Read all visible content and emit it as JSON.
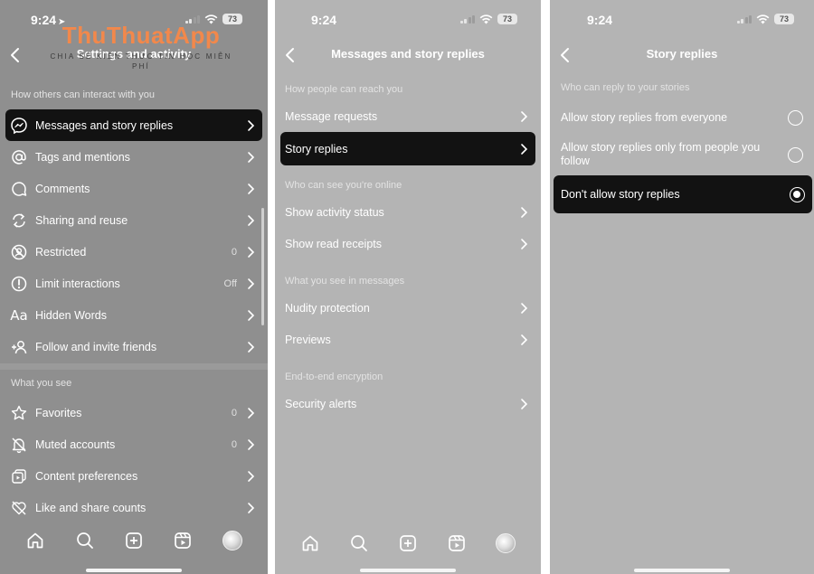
{
  "watermark": {
    "brand": "ThuThuatApp",
    "tagline": "CHIA SẺ KIẾN THỨC TIN HỌC MIỄN PHÍ"
  },
  "screens": [
    {
      "status": {
        "time": "9:24",
        "battery": "73"
      },
      "title": "Settings and activity",
      "sections": [
        {
          "heading": "How others can interact with you",
          "items": [
            {
              "label": "Messages and story replies",
              "icon": "messenger-icon",
              "value": ""
            },
            {
              "label": "Tags and mentions",
              "icon": "at-sign-icon",
              "value": ""
            },
            {
              "label": "Comments",
              "icon": "comment-icon",
              "value": ""
            },
            {
              "label": "Sharing and reuse",
              "icon": "share-reuse-icon",
              "value": ""
            },
            {
              "label": "Restricted",
              "icon": "restricted-icon",
              "value": "0"
            },
            {
              "label": "Limit interactions",
              "icon": "alert-circle-icon",
              "value": "Off"
            },
            {
              "label": "Hidden Words",
              "icon": "text-aa-icon",
              "value": ""
            },
            {
              "label": "Follow and invite friends",
              "icon": "add-person-icon",
              "value": ""
            }
          ]
        },
        {
          "heading": "What you see",
          "items": [
            {
              "label": "Favorites",
              "icon": "star-icon",
              "value": "0"
            },
            {
              "label": "Muted accounts",
              "icon": "muted-bell-icon",
              "value": "0"
            },
            {
              "label": "Content preferences",
              "icon": "content-icon",
              "value": ""
            },
            {
              "label": "Like and share counts",
              "icon": "heart-slash-icon",
              "value": ""
            }
          ]
        }
      ]
    },
    {
      "status": {
        "time": "9:24",
        "battery": "73"
      },
      "title": "Messages and story replies",
      "sections": [
        {
          "heading": "How people can reach you",
          "items": [
            {
              "label": "Message requests"
            },
            {
              "label": "Story replies"
            }
          ]
        },
        {
          "heading": "Who can see you're online",
          "items": [
            {
              "label": "Show activity status"
            },
            {
              "label": "Show read receipts"
            }
          ]
        },
        {
          "heading": "What you see in messages",
          "items": [
            {
              "label": "Nudity protection"
            },
            {
              "label": "Previews"
            }
          ]
        },
        {
          "heading": "End-to-end encryption",
          "items": [
            {
              "label": "Security alerts"
            }
          ]
        }
      ]
    },
    {
      "status": {
        "time": "9:24",
        "battery": "73"
      },
      "title": "Story replies",
      "heading": "Who can reply to your stories",
      "options": [
        {
          "label": "Allow story replies from everyone",
          "selected": false
        },
        {
          "label": "Allow story replies only from people you follow",
          "selected": false
        },
        {
          "label": "Don't allow story replies",
          "selected": true
        }
      ]
    }
  ]
}
